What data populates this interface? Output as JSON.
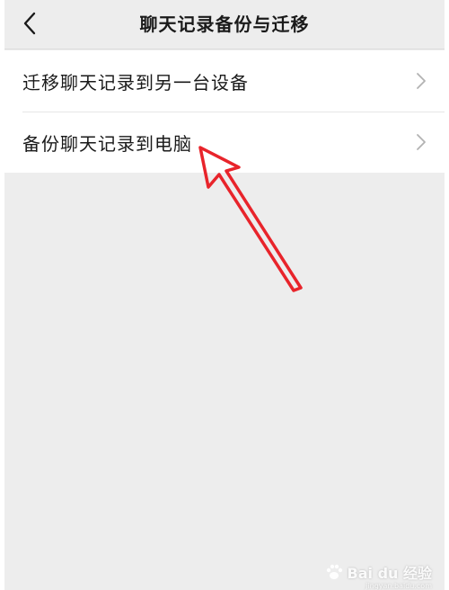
{
  "header": {
    "back_icon": "chevron-left-icon",
    "title": "聊天记录备份与迁移"
  },
  "menu": {
    "items": [
      {
        "label": "迁移聊天记录到另一台设备",
        "icon": "chevron-right-icon"
      },
      {
        "label": "备份聊天记录到电脑",
        "icon": "chevron-right-icon"
      }
    ]
  },
  "annotation": {
    "type": "arrow",
    "color": "#e8242b",
    "points_to": "menu.items.1"
  },
  "watermark": {
    "text": "Bai du 经验",
    "sub": "jingyan.baidu.com"
  },
  "colors": {
    "background": "#ededed",
    "list_background": "#ffffff",
    "text": "#1a1a1a",
    "chevron": "#b2b2b2",
    "arrow": "#e8242b"
  }
}
